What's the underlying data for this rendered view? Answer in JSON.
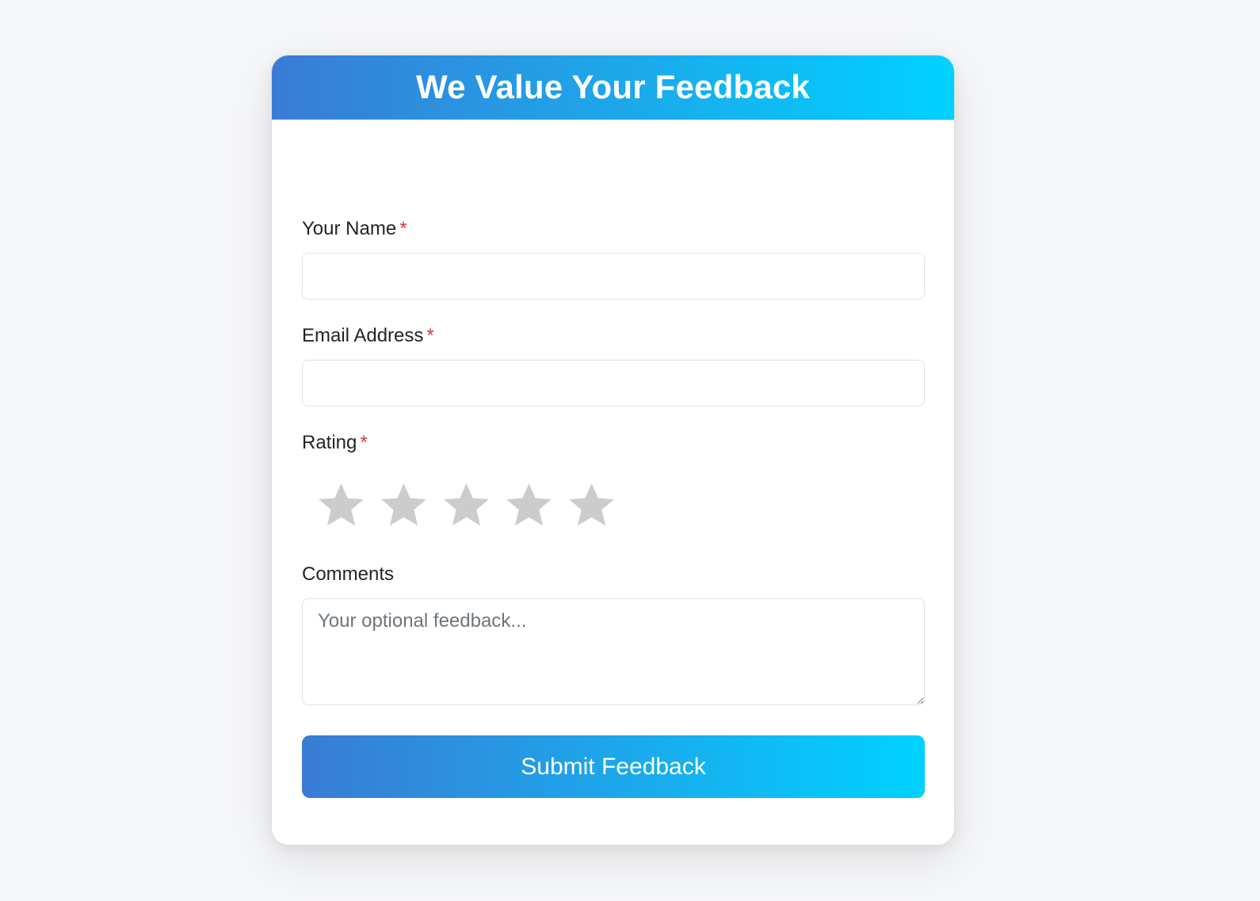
{
  "header": {
    "title": "We Value Your Feedback"
  },
  "form": {
    "name": {
      "label": "Your Name",
      "required_mark": "*",
      "value": ""
    },
    "email": {
      "label": "Email Address",
      "required_mark": "*",
      "value": ""
    },
    "rating": {
      "label": "Rating",
      "required_mark": "*",
      "max_stars": 5,
      "selected": 0,
      "star_icon": "star-icon",
      "empty_color": "#cccccc"
    },
    "comments": {
      "label": "Comments",
      "placeholder": "Your optional feedback...",
      "value": ""
    },
    "submit_label": "Submit Feedback"
  },
  "colors": {
    "gradient_start": "#3a7bd5",
    "gradient_end": "#00d2ff",
    "required": "#dc3545"
  }
}
